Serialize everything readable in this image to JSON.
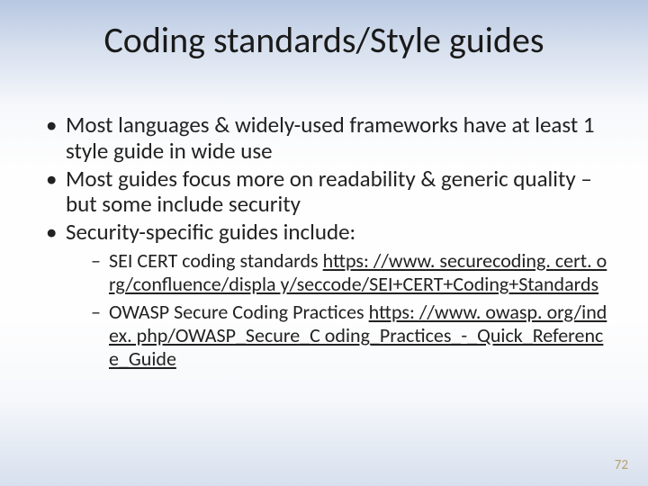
{
  "title": "Coding standards/Style guides",
  "bullets": {
    "b1": "Most languages & widely-used frameworks have at least 1 style guide in wide use",
    "b2": "Most guides focus more on readability & generic quality – but some include security",
    "b3": "Security-specific guides include:"
  },
  "sub": {
    "s1_label": "SEI CERT coding standards",
    "s1_link": "https: //www. securecoding. cert. org/confluence/displa y/seccode/SEI+CERT+Coding+Standards",
    "s2_label": "OWASP Secure Coding Practices",
    "s2_link": "https: //www. owasp. org/index. php/OWASP_Secure_C oding_Practices_-_Quick_Reference_Guide"
  },
  "page_number": "72"
}
